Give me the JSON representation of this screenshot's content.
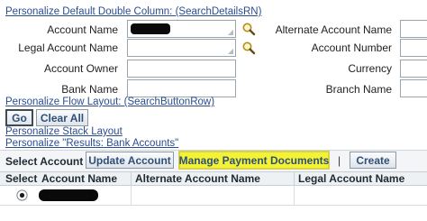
{
  "links": {
    "personalize_double_column": "Personalize Default Double Column: (SearchDetailsRN)",
    "personalize_flow_layout": "Personalize Flow Layout: (SearchButtonRow)",
    "personalize_stack_layout": "Personalize Stack Layout",
    "personalize_results": "Personalize \"Results: Bank Accounts\""
  },
  "search": {
    "left_labels": [
      "Account Name",
      "Legal Account Name",
      "Account Owner",
      "Bank Name"
    ],
    "right_labels": [
      "Alternate Account Name",
      "Account Number",
      "Currency",
      "Branch Name"
    ]
  },
  "buttons": {
    "go": "Go",
    "clear_all": "Clear All"
  },
  "toolbar": {
    "select_account_label": "Select Account",
    "update_account": "Update Account",
    "manage_payment_documents": "Manage Payment Documents",
    "separator": "|",
    "create": "Create"
  },
  "table": {
    "columns": [
      "Select",
      "Account Name",
      "Alternate Account Name",
      "Legal Account Name"
    ]
  },
  "colors": {
    "link": "#2a4d8f",
    "highlight": "#f3f234"
  },
  "icons": {
    "search": "magnifier-icon",
    "radio": "radio-selected-icon"
  }
}
